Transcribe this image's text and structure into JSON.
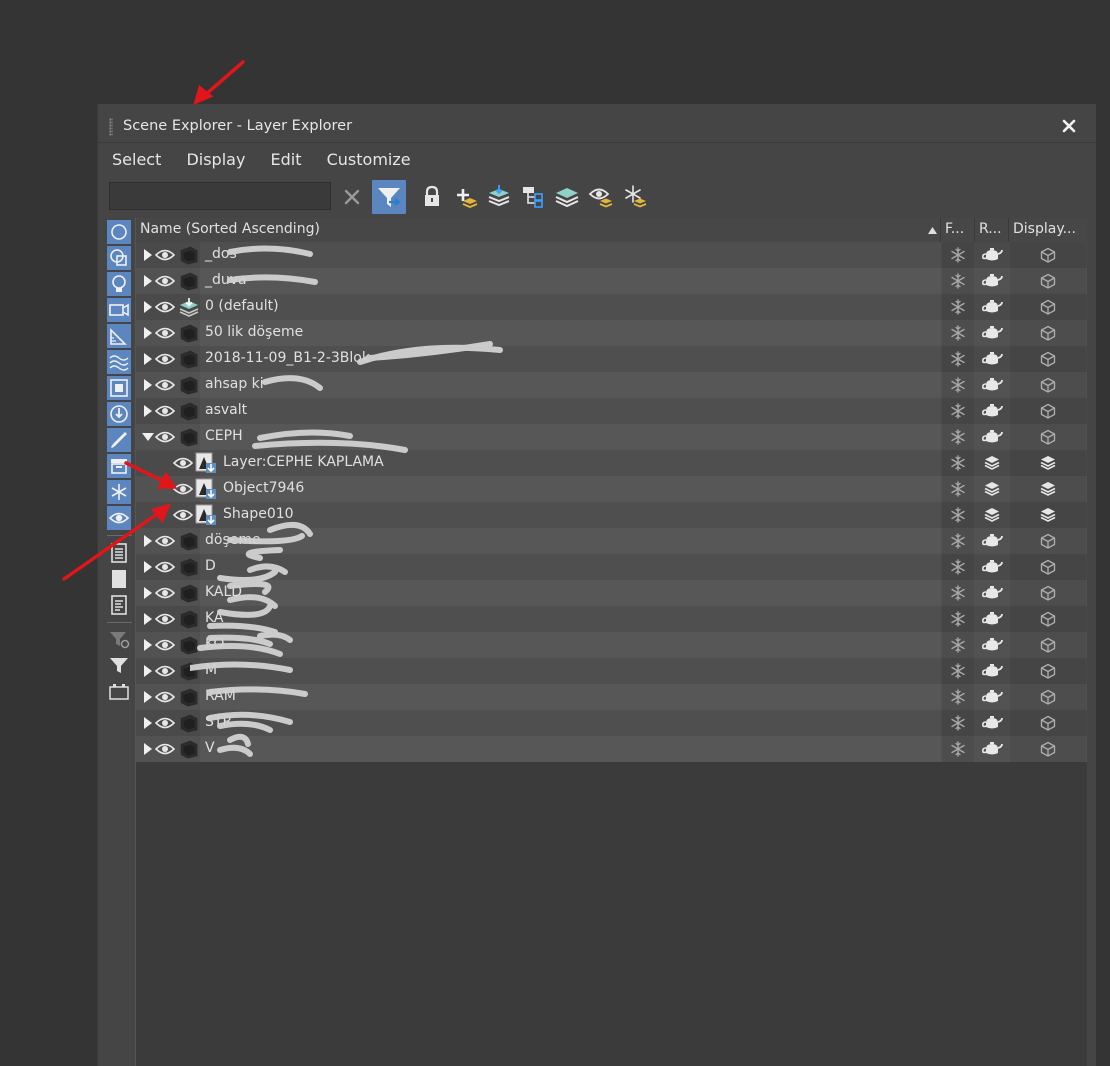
{
  "window": {
    "title": "Scene Explorer - Layer Explorer",
    "close_icon": "close-icon"
  },
  "menu": [
    "Select",
    "Display",
    "Edit",
    "Customize"
  ],
  "search": {
    "value": "",
    "placeholder": ""
  },
  "toolbar_icons": [
    "clear-icon",
    "filter-icon",
    "lock-icon",
    "add-layer-icon",
    "layers-icon",
    "hierarchy-icon",
    "stack-icon",
    "eye-layers-icon",
    "freeze-icon"
  ],
  "columns": {
    "name": "Name (Sorted Ascending)",
    "freeze": "F...",
    "render": "R...",
    "display": "Display..."
  },
  "rows": [
    {
      "label": "_dos",
      "level": 0,
      "expanded": false,
      "kind": "layer"
    },
    {
      "label": "_duva",
      "level": 0,
      "expanded": false,
      "kind": "layer"
    },
    {
      "label": "0 (default)",
      "level": 0,
      "expanded": false,
      "kind": "default"
    },
    {
      "label": "50 lik döşeme",
      "level": 0,
      "expanded": false,
      "kind": "layer"
    },
    {
      "label": "2018-11-09_B1-2-3Blok",
      "level": 0,
      "expanded": false,
      "kind": "layer"
    },
    {
      "label": "ahsap ki",
      "level": 0,
      "expanded": false,
      "kind": "layer"
    },
    {
      "label": "asvalt",
      "level": 0,
      "expanded": false,
      "kind": "layer"
    },
    {
      "label": "CEPH",
      "level": 0,
      "expanded": true,
      "kind": "layer"
    },
    {
      "label": "Layer:CEPHE KAPLAMA",
      "level": 1,
      "expanded": false,
      "kind": "object"
    },
    {
      "label": "Object7946",
      "level": 1,
      "expanded": false,
      "kind": "object"
    },
    {
      "label": "Shape010",
      "level": 1,
      "expanded": false,
      "kind": "object"
    },
    {
      "label": "döşeme",
      "level": 0,
      "expanded": false,
      "kind": "layer"
    },
    {
      "label": "D",
      "level": 0,
      "expanded": false,
      "kind": "layer"
    },
    {
      "label": "KALD",
      "level": 0,
      "expanded": false,
      "kind": "layer"
    },
    {
      "label": "KA",
      "level": 0,
      "expanded": false,
      "kind": "layer"
    },
    {
      "label": "KO",
      "level": 0,
      "expanded": false,
      "kind": "layer"
    },
    {
      "label": "M",
      "level": 0,
      "expanded": false,
      "kind": "layer"
    },
    {
      "label": "RAM",
      "level": 0,
      "expanded": false,
      "kind": "layer"
    },
    {
      "label": "STR",
      "level": 0,
      "expanded": false,
      "kind": "layer"
    },
    {
      "label": "V",
      "level": 0,
      "expanded": false,
      "kind": "layer"
    }
  ],
  "colors": {
    "accent": "#5b86c0",
    "arrow": "#e0161a",
    "panel": "#454545",
    "background": "#343434"
  }
}
